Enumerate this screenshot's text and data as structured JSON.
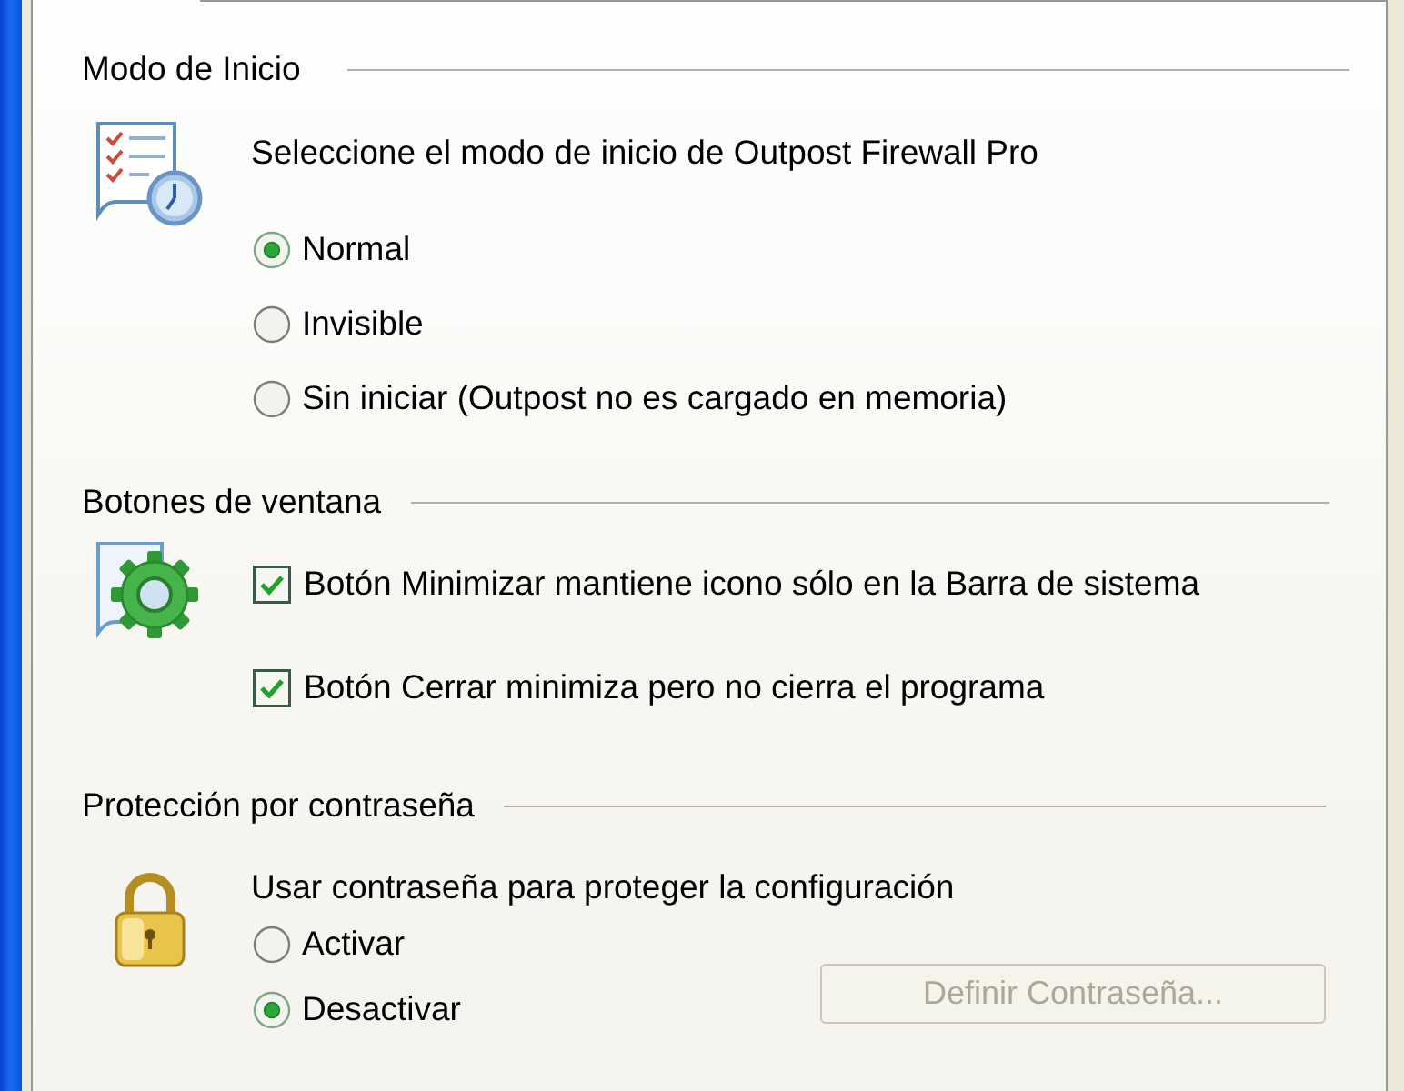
{
  "sections": [
    {
      "title": "Modo de Inicio",
      "prompt": "Seleccione el modo de inicio de Outpost Firewall Pro",
      "options": [
        {
          "kind": "radio",
          "label": "Normal",
          "selected": true
        },
        {
          "kind": "radio",
          "label": "Invisible",
          "selected": false
        },
        {
          "kind": "radio",
          "label": "Sin iniciar (Outpost no es cargado en memoria)",
          "selected": false
        }
      ]
    },
    {
      "title": "Botones de ventana",
      "options": [
        {
          "kind": "checkbox",
          "label": "Botón Minimizar mantiene icono sólo en la Barra de sistema",
          "checked": true
        },
        {
          "kind": "checkbox",
          "label": "Botón Cerrar minimiza pero no cierra el programa",
          "checked": true
        }
      ]
    },
    {
      "title": "Protección por contraseña",
      "prompt": "Usar contraseña para proteger la configuración",
      "options": [
        {
          "kind": "radio",
          "label": "Activar",
          "selected": false
        },
        {
          "kind": "radio",
          "label": "Desactivar",
          "selected": true
        }
      ],
      "button": {
        "label": "Definir Contraseña...",
        "disabled": true
      }
    }
  ]
}
